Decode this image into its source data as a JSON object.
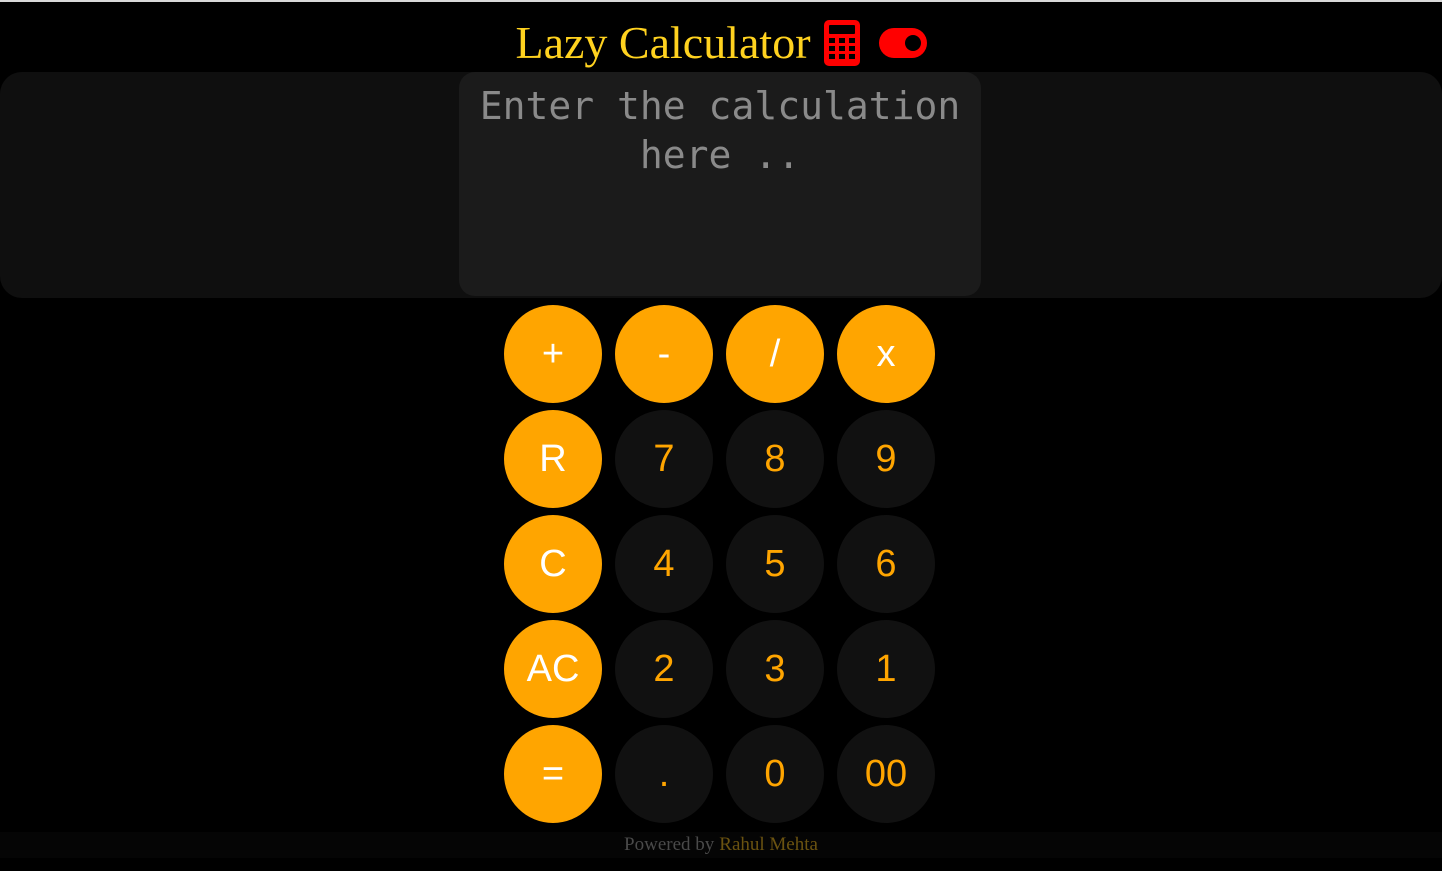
{
  "header": {
    "title": "Lazy Calculator",
    "icon": "calculator-icon",
    "toggle_icon": "toggle-on-icon",
    "accent_color": "#ffd21f",
    "icon_color": "#ff0000"
  },
  "display": {
    "value": "",
    "placeholder": "Enter the calculation here .."
  },
  "keypad": {
    "rows": [
      [
        "+",
        "-",
        "/",
        "x"
      ],
      [
        "R",
        "7",
        "8",
        "9"
      ],
      [
        "C",
        "4",
        "5",
        "6"
      ],
      [
        "AC",
        "2",
        "3",
        "1"
      ],
      [
        "=",
        ".",
        "0",
        "00"
      ]
    ],
    "operator_color": "#ffa500",
    "number_bg": "#111111"
  },
  "footer": {
    "prefix": "Powered by",
    "author": "Rahul Mehta"
  }
}
